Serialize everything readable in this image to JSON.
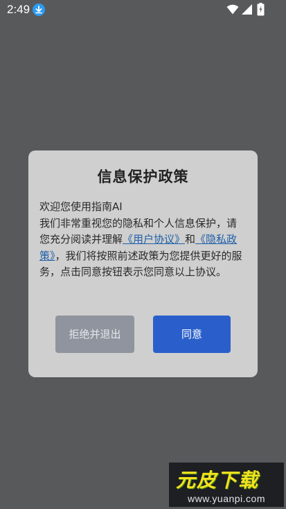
{
  "status_bar": {
    "time": "2:49",
    "icons": [
      "download-icon",
      "wifi-icon",
      "signal-icon",
      "battery-icon"
    ]
  },
  "dialog": {
    "title": "信息保护政策",
    "body": {
      "line1": "欢迎您使用指南AI",
      "text_before_links": "我们非常重视您的隐私和个人信息保护，请您充分阅读并理解",
      "link_user_agreement": "《用户协议》",
      "connector": "和",
      "link_privacy_policy": "《隐私政策》",
      "text_after_links": "，我们将按照前述政策为您提供更好的服务，点击同意按钮表示您同意以上协议。"
    },
    "decline_label": "拒绝并退出",
    "agree_label": "同意"
  },
  "colors": {
    "backdrop": "#58595b",
    "dialog_bg": "#cfcfcf",
    "agree_button": "#2a5fcb",
    "decline_button": "#8f949e",
    "link": "#1f5fa8"
  },
  "watermark": {
    "logo_text": "元皮下载",
    "url": "www.yuanpi.com"
  }
}
